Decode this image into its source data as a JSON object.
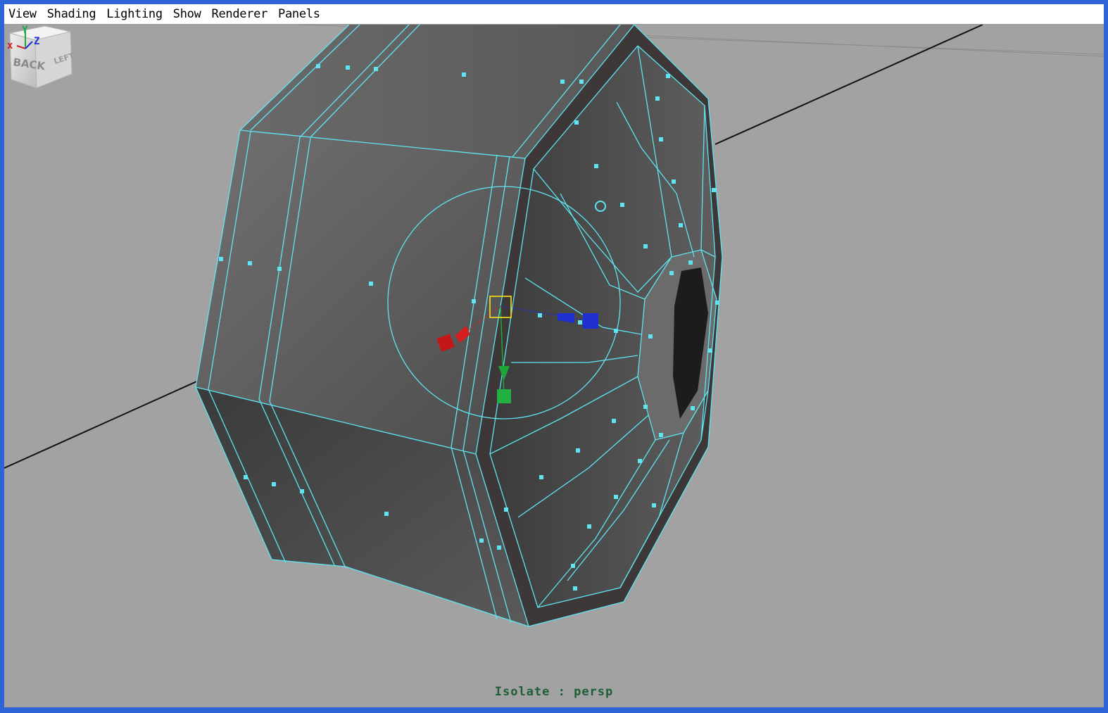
{
  "menubar": {
    "items": [
      {
        "label": "View"
      },
      {
        "label": "Shading"
      },
      {
        "label": "Lighting"
      },
      {
        "label": "Show"
      },
      {
        "label": "Renderer"
      },
      {
        "label": "Panels"
      }
    ]
  },
  "viewport": {
    "hud_label": "Isolate : persp",
    "background_color": "#a2a2a2",
    "wireframe_color": "#5fe4f2"
  },
  "viewcube": {
    "front_label": "BACK",
    "side_label": "LEFT"
  },
  "axis_triad": {
    "x_label": "x",
    "y_label": "Y",
    "z_label": "Z"
  },
  "manipulator": {
    "x_color": "#d42020",
    "y_color": "#1fa63a",
    "z_color": "#1e2fd0",
    "pivot_color": "#e8d21c"
  }
}
